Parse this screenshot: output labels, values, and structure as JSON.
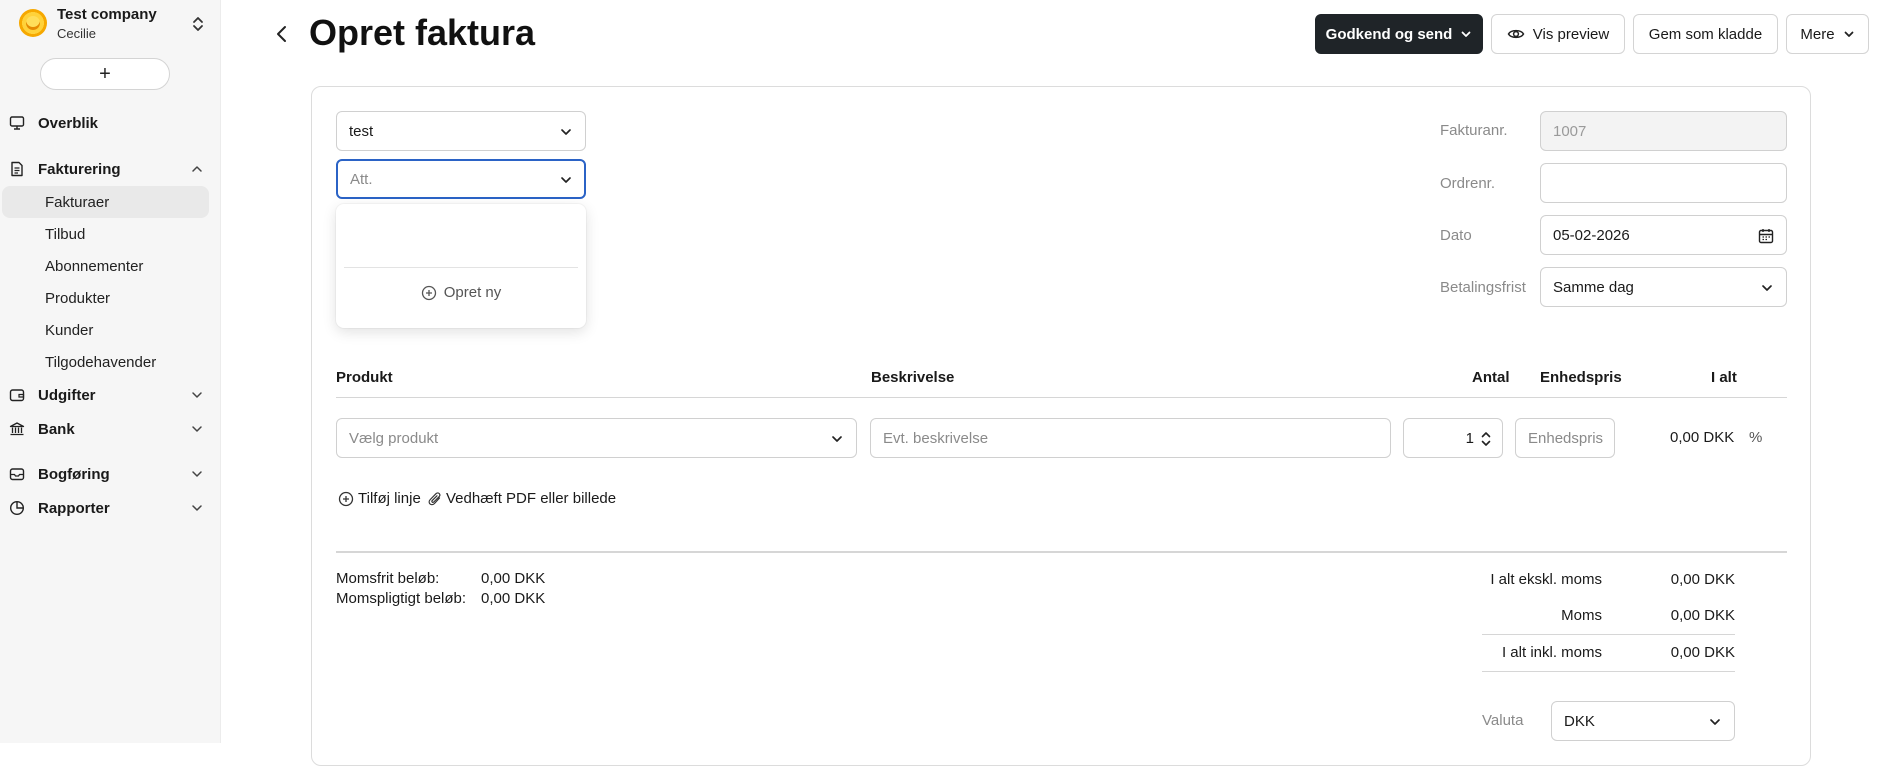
{
  "sidebar": {
    "company_name": "Test company",
    "user_name": "Cecilie",
    "new_button_label": "+",
    "nav": {
      "overview": "Overblik",
      "billing": "Fakturering",
      "expenses": "Udgifter",
      "bank": "Bank",
      "bookkeeping": "Bogføring",
      "reports": "Rapporter"
    },
    "billing_items": [
      "Fakturaer",
      "Tilbud",
      "Abonnementer",
      "Produkter",
      "Kunder",
      "Tilgodehavender"
    ]
  },
  "header": {
    "title": "Opret faktura",
    "approve_send": "Godkend og send",
    "preview": "Vis preview",
    "save_draft": "Gem som kladde",
    "more": "Mere"
  },
  "form": {
    "customer_value": "test",
    "att_placeholder": "Att.",
    "dropdown_create": "Opret ny",
    "invoice_no_label": "Fakturanr.",
    "invoice_no_value": "1007",
    "order_no_label": "Ordrenr.",
    "order_no_value": "",
    "date_label": "Dato",
    "date_value": "05-02-2026",
    "payment_label": "Betalingsfrist",
    "payment_value": "Samme dag"
  },
  "table": {
    "headers": {
      "product": "Produkt",
      "description": "Beskrivelse",
      "qty": "Antal",
      "unit_price": "Enhedspris",
      "total": "I alt"
    },
    "row": {
      "product_placeholder": "Vælg produkt",
      "description_placeholder": "Evt. beskrivelse",
      "qty": "1",
      "unit_price_placeholder": "Enhedspris",
      "total": "0,00 DKK",
      "percent": "%"
    }
  },
  "actions": {
    "add_line": "Tilføj linje",
    "attach": "Vedhæft PDF eller billede"
  },
  "summary": {
    "vat_free_label": "Momsfrit beløb:",
    "vat_free_value": "0,00 DKK",
    "vat_liable_label": "Momspligtigt beløb:",
    "vat_liable_value": "0,00 DKK",
    "excl_label": "I alt ekskl. moms",
    "excl_value": "0,00 DKK",
    "vat_label": "Moms",
    "vat_value": "0,00 DKK",
    "incl_label": "I alt inkl. moms",
    "incl_value": "0,00 DKK",
    "currency_label": "Valuta",
    "currency_value": "DKK"
  },
  "colors": {
    "primary_button": "#1f2428",
    "focus_border": "#2b63c6",
    "sidebar_bg": "#f6f6f6"
  },
  "icons": [
    "chevron-updown-icon",
    "monitor-icon",
    "invoice-icon",
    "chevron-up-icon",
    "chevron-down-icon",
    "wallet-icon",
    "bank-icon",
    "inbox-icon",
    "pie-chart-icon",
    "chevron-left-icon",
    "eye-icon",
    "calendar-icon",
    "plus-circle-icon",
    "paperclip-icon",
    "stepper-icon"
  ]
}
